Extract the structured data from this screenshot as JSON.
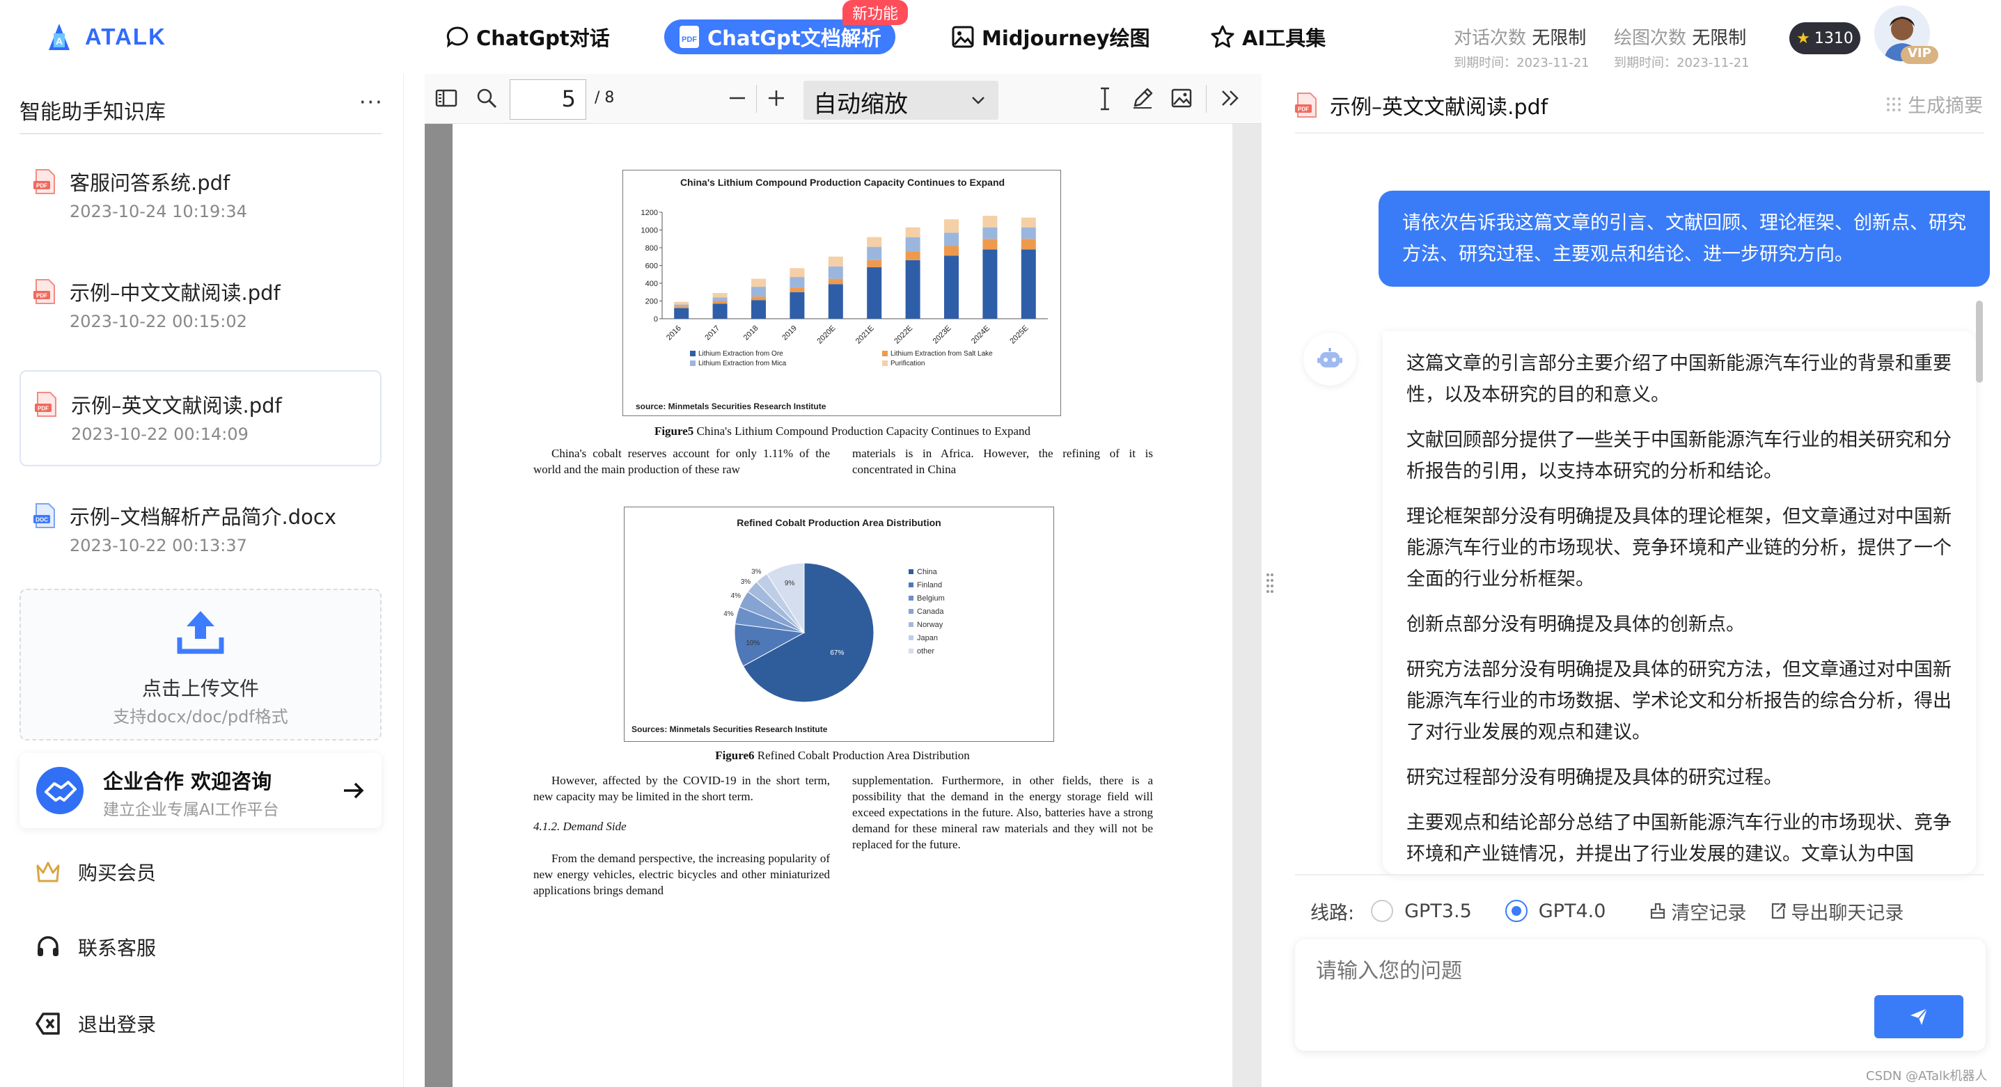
{
  "header": {
    "logo_text": "ATALK",
    "nav": [
      {
        "label": "ChatGpt对话"
      },
      {
        "label": "ChatGpt文档解析"
      },
      {
        "label": "Midjourney绘图"
      },
      {
        "label": "AI工具集"
      }
    ],
    "new_badge": "新功能",
    "quota_chat_label": "对话次数",
    "quota_chat_value": "无限制",
    "quota_chat_expire": "到期时间：2023-11-21",
    "quota_draw_label": "绘图次数",
    "quota_draw_value": "无限制",
    "quota_draw_expire": "到期时间：2023-11-21",
    "points": "1310",
    "vip_label": "VIP"
  },
  "sidebar": {
    "title": "智能助手知识库",
    "more": "···",
    "files": [
      {
        "name": "客服问答系统.pdf",
        "date": "2023-10-24 10:19:34",
        "type": "pdf",
        "selected": false
      },
      {
        "name": "示例–中文文献阅读.pdf",
        "date": "2023-10-22 00:15:02",
        "type": "pdf",
        "selected": false
      },
      {
        "name": "示例–英文文献阅读.pdf",
        "date": "2023-10-22 00:14:09",
        "type": "pdf",
        "selected": true
      },
      {
        "name": "示例–文档解析产品简介.docx",
        "date": "2023-10-22 00:13:37",
        "type": "doc",
        "selected": false
      }
    ],
    "upload_label": "点击上传文件",
    "upload_hint": "支持docx/doc/pdf格式",
    "coop_title": "企业合作 欢迎咨询",
    "coop_sub": "建立企业专属AI工作平台",
    "menu": [
      {
        "label": "购买会员",
        "icon": "crown-icon"
      },
      {
        "label": "联系客服",
        "icon": "headset-icon"
      },
      {
        "label": "退出登录",
        "icon": "logout-icon"
      }
    ]
  },
  "viewer": {
    "page_number": "5",
    "page_total": "/ 8",
    "zoom": "自动缩放",
    "figure5": {
      "title": "China's Lithium Compound Production Capacity Continues to Expand",
      "source": "source:  Minmetals Securities Research Institute",
      "caption_bold": "Figure5",
      "caption_text": " China's Lithium Compound Production Capacity Continues to Expand"
    },
    "figure6": {
      "title": "Refined Cobalt Production Area Distribution",
      "source": "Sources:  Minmetals Securities Research Institute",
      "caption_bold": "Figure6",
      "caption_text": " Refined Cobalt Production Area Distribution"
    },
    "text": {
      "p1_left": "China's cobalt reserves account for only 1.11% of the world and the main production of these raw",
      "p1_right": "materials is in Africa. However, the refining of it is concentrated in China",
      "p2_left": "However, affected by the COVID-19 in the short term, new capacity may be limited in the short term.",
      "heading": "4.1.2. Demand Side",
      "p3_left": "From the demand perspective, the increasing popularity of new energy vehicles, electric bicycles and other miniaturized applications brings demand",
      "p2_right": "supplementation. Furthermore, in other fields, there is a possibility that the demand in the energy storage field will exceed expectations in the future. Also, batteries have a strong demand for these mineral raw materials and they will not be replaced for the future."
    }
  },
  "chart_data": [
    {
      "type": "bar",
      "title": "China's Lithium Compound Production Capacity Continues to Expand",
      "categories": [
        "2016",
        "2017",
        "2018",
        "2019",
        "2020E",
        "2021E",
        "2022E",
        "2023E",
        "2024E",
        "2025E"
      ],
      "ylim": [
        0,
        1200
      ],
      "yticks": [
        "0",
        "200",
        "400",
        "600",
        "800",
        "1000",
        "1200"
      ],
      "stacked": true,
      "series": [
        {
          "name": "Lithium Extraction from Ore",
          "color": "#2e5ea8",
          "values": [
            120,
            170,
            210,
            300,
            390,
            580,
            660,
            710,
            780,
            780
          ]
        },
        {
          "name": "Lithium Extraction from Salt Lake",
          "color": "#ee9a4d",
          "values": [
            20,
            30,
            40,
            50,
            60,
            80,
            100,
            110,
            120,
            120
          ]
        },
        {
          "name": "Lithium Extraction from Mica",
          "color": "#9bb6dd",
          "values": [
            20,
            40,
            110,
            120,
            140,
            150,
            160,
            150,
            130,
            130
          ]
        },
        {
          "name": "Purification",
          "color": "#f5cfa6",
          "values": [
            30,
            50,
            90,
            100,
            110,
            110,
            110,
            150,
            130,
            110
          ]
        }
      ]
    },
    {
      "type": "pie",
      "title": "Refined Cobalt Production Area Distribution",
      "slices": [
        {
          "label": "China",
          "value": 67,
          "text": "67%",
          "color": "#2f5d9c"
        },
        {
          "label": "Finland",
          "value": 10,
          "text": "10%",
          "color": "#4f78b8"
        },
        {
          "label": "Belgium",
          "value": 4,
          "text": "4%",
          "color": "#6b8fc7"
        },
        {
          "label": "Canada",
          "value": 4,
          "text": "4%",
          "color": "#86a3d1"
        },
        {
          "label": "Norway",
          "value": 3,
          "text": "3%",
          "color": "#a4badc"
        },
        {
          "label": "Japan",
          "value": 3,
          "text": "3%",
          "color": "#bfcee6"
        },
        {
          "label": "other",
          "value": 9,
          "text": "9%",
          "color": "#d5deee"
        }
      ]
    }
  ],
  "chat": {
    "file_title": "示例–英文文献阅读.pdf",
    "summary_button": "生成摘要",
    "user_message": "请依次告诉我这篇文章的引言、文献回顾、理论框架、创新点、研究方法、研究过程、主要观点和结论、进一步研究方向。",
    "bot_paragraphs": [
      "这篇文章的引言部分主要介绍了中国新能源汽车行业的背景和重要性，以及本研究的目的和意义。",
      "文献回顾部分提供了一些关于中国新能源汽车行业的相关研究和分析报告的引用，以支持本研究的分析和结论。",
      "理论框架部分没有明确提及具体的理论框架，但文章通过对中国新能源汽车行业的市场现状、竞争环境和产业链的分析，提供了一个全面的行业分析框架。",
      "创新点部分没有明确提及具体的创新点。",
      "研究方法部分没有明确提及具体的研究方法，但文章通过对中国新能源汽车行业的市场数据、学术论文和分析报告的综合分析，得出了对行业发展的观点和建议。",
      "研究过程部分没有明确提及具体的研究过程。",
      "主要观点和结论部分总结了中国新能源汽车行业的市场现状、竞争环境和产业链情况，并提出了行业发展的建议。文章认为中国"
    ],
    "route_label": "线路:",
    "options": [
      "GPT3.5",
      "GPT4.0"
    ],
    "selected_option": "GPT4.0",
    "clear_label": "清空记录",
    "export_label": "导出聊天记录",
    "input_placeholder": "请输入您的问题",
    "accent_color": "#3a7cf7"
  },
  "footer": "CSDN @ATalk机器人"
}
